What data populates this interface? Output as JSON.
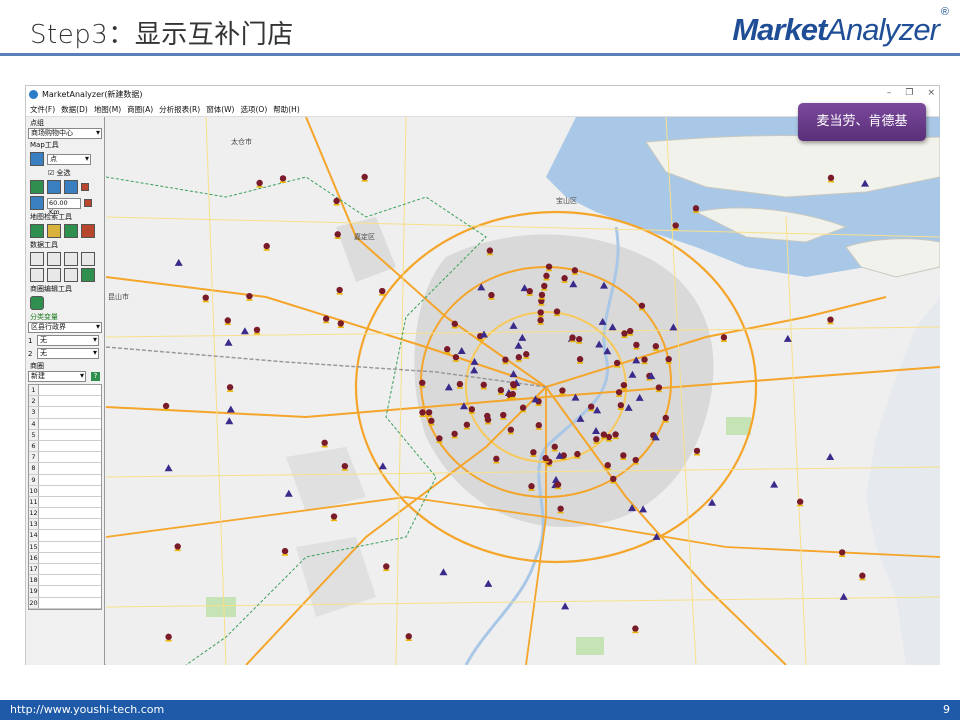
{
  "slide": {
    "title": "Step3：显示互补门店",
    "brand_bold": "Market",
    "brand_light": "Analyzer",
    "brand_mark": "®",
    "footer_url": "http://www.youshi-tech.com",
    "page_number": "9"
  },
  "window": {
    "title": "MarketAnalyzer(新建数据)",
    "controls": [
      "–",
      "❐",
      "×"
    ]
  },
  "menu": [
    "文件(F)",
    "数据(D)",
    "地图(M)",
    "商圈(A)",
    "分析报表(R)",
    "窗体(W)",
    "选项(O)",
    "帮助(H)"
  ],
  "panel": {
    "point_group_label": "点组",
    "point_group_value": "商场购物中心",
    "map_tools_label": "Map工具",
    "map_tool_type": "点",
    "select_all": "全选",
    "distance_value": "60.00 Km",
    "map_search_label": "地图检索工具",
    "data_tools_label": "数据工具",
    "trade_area_edit_label": "商圈编辑工具",
    "classify_label": "分类变量",
    "classify_value": "区县行政界",
    "var1_label": "1",
    "var1_value": "无",
    "var2_label": "2",
    "var2_value": "无",
    "trade_area_label": "商圈",
    "trade_area_value": "新建",
    "rows": [
      "1",
      "2",
      "3",
      "4",
      "5",
      "6",
      "7",
      "8",
      "9",
      "10",
      "11",
      "12",
      "13",
      "14",
      "15",
      "16",
      "17",
      "18",
      "19",
      "20"
    ]
  },
  "map": {
    "place_labels": [
      "太仓市",
      "宝山区",
      "嘉定区",
      "昆山市"
    ],
    "colors": {
      "water": "#a9c7e6",
      "urban": "#d9d9d9",
      "road_major": "#f4a52a",
      "road_minor": "#f7e08a",
      "green": "#c6e3b5",
      "brand_a": "#7a1b2a",
      "brand_b": "#3b2a8a"
    }
  },
  "legend": {
    "text": "麦当劳、肯德基"
  }
}
